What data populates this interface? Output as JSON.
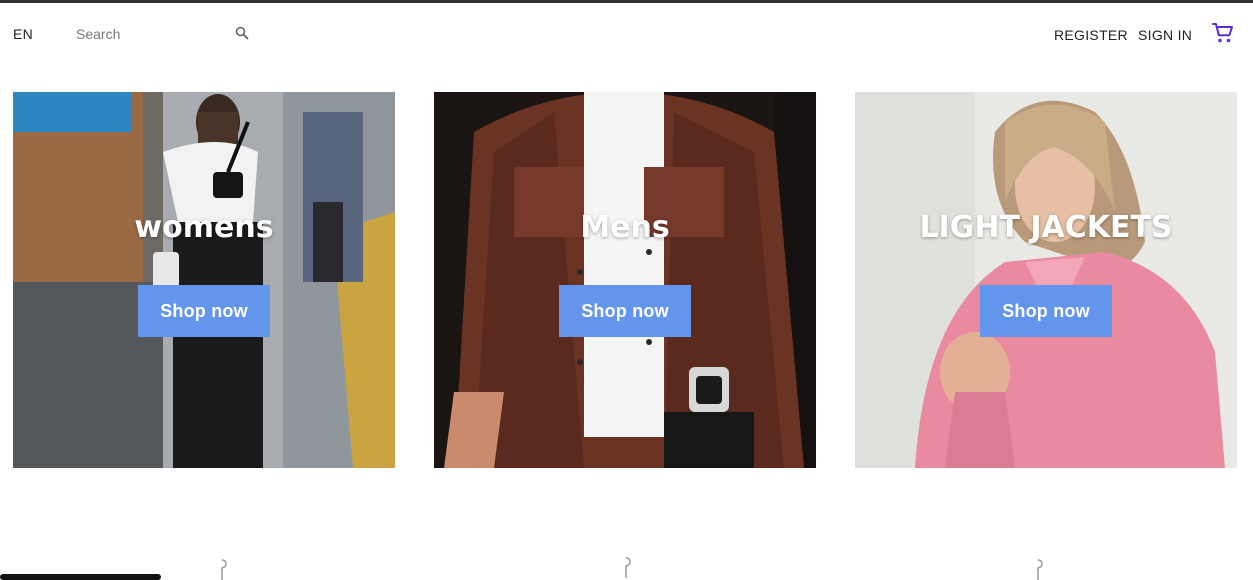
{
  "header": {
    "language": "EN",
    "search_placeholder": "Search",
    "register_label": "REGISTER",
    "sign_in_label": "SIGN IN",
    "icons": {
      "search": "search-icon",
      "cart": "shopping-cart-icon"
    },
    "cart_color": "#5b2bd6"
  },
  "categories": [
    {
      "title": "womens",
      "button_label": "Shop now"
    },
    {
      "title": "Mens",
      "button_label": "Shop now"
    },
    {
      "title": "LIGHT JACKETS",
      "button_label": "Shop now"
    }
  ],
  "colors": {
    "button_bg": "#6495ed",
    "button_text": "#ffffff",
    "title_text": "#ffffff"
  }
}
